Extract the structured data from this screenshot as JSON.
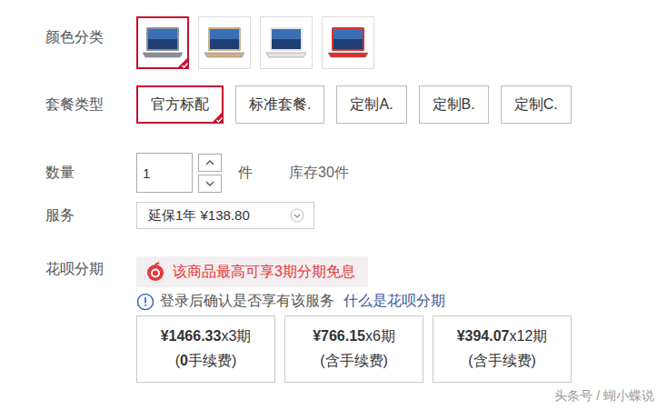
{
  "color_options": {
    "label": "颜色分类",
    "items": [
      {
        "color": "#8a8f99",
        "selected": true
      },
      {
        "color": "#c9b28a",
        "selected": false
      },
      {
        "color": "#e6e6e8",
        "selected": false
      },
      {
        "color": "#d8322f",
        "selected": false
      }
    ]
  },
  "package": {
    "label": "套餐类型",
    "items": [
      {
        "label": "官方标配",
        "selected": true
      },
      {
        "label": "标准套餐.",
        "selected": false
      },
      {
        "label": "定制A.",
        "selected": false
      },
      {
        "label": "定制B.",
        "selected": false
      },
      {
        "label": "定制C.",
        "selected": false
      }
    ]
  },
  "quantity": {
    "label": "数量",
    "value": "1",
    "unit": "件",
    "stock": "库存30件"
  },
  "service": {
    "label": "服务",
    "value": "延保1年 ¥138.80"
  },
  "huabei": {
    "label": "花呗分期",
    "promo": "该商品最高可享3期分期免息",
    "notice": "登录后确认是否享有该服务",
    "link": "什么是花呗分期",
    "plans": [
      {
        "amount": "¥1466.33",
        "periods": "x3期",
        "fee_parts": [
          {
            "text": "(",
            "bold": false
          },
          {
            "text": "0",
            "bold": true
          },
          {
            "text": "手续费)",
            "bold": false
          }
        ]
      },
      {
        "amount": "¥766.15",
        "periods": "x6期",
        "fee_parts": [
          {
            "text": "(含手续费)",
            "bold": false
          }
        ]
      },
      {
        "amount": "¥394.07",
        "periods": "x12期",
        "fee_parts": [
          {
            "text": "(含手续费)",
            "bold": false
          }
        ]
      }
    ]
  },
  "watermark": "头条号 / 蝴小蝶说"
}
